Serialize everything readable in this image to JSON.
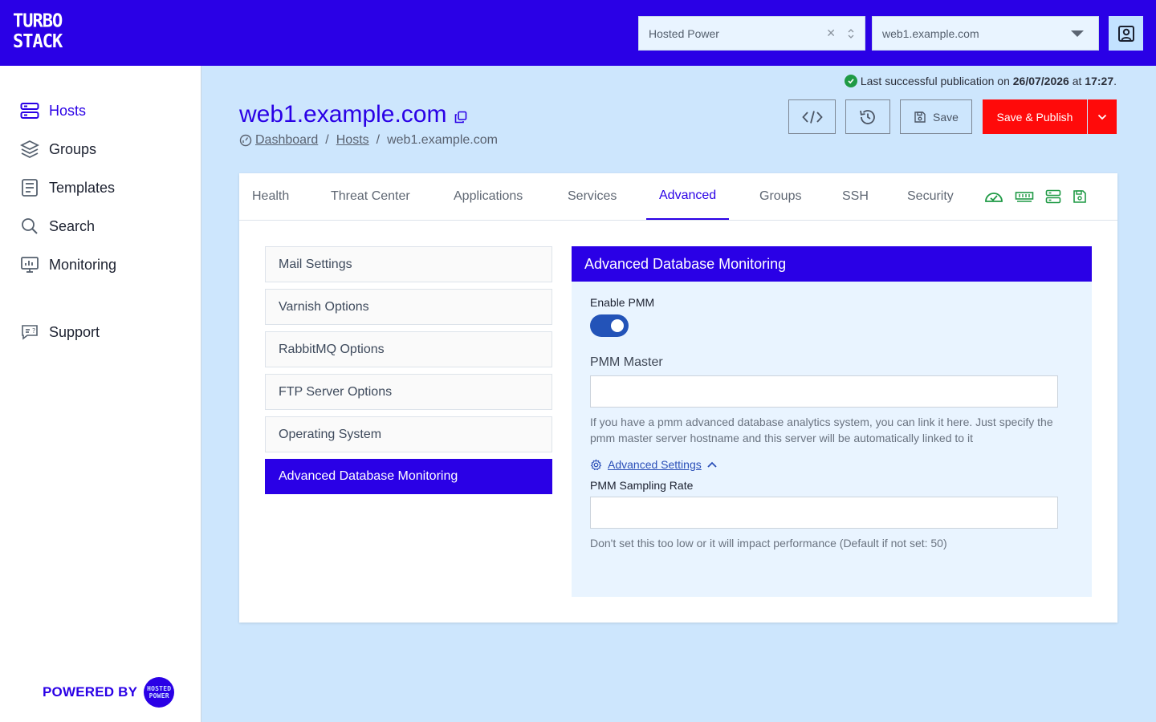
{
  "header": {
    "logo_line1": "TURBO",
    "logo_line2": "STACK",
    "org_select": {
      "value": "Hosted Power"
    },
    "host_select": {
      "value": "web1.example.com"
    }
  },
  "sidebar": {
    "items": [
      {
        "label": "Hosts",
        "icon": "server-icon",
        "active": true
      },
      {
        "label": "Groups",
        "icon": "layers-icon"
      },
      {
        "label": "Templates",
        "icon": "template-icon"
      },
      {
        "label": "Search",
        "icon": "search-icon"
      },
      {
        "label": "Monitoring",
        "icon": "monitor-icon"
      },
      {
        "label": "Support",
        "icon": "support-icon"
      }
    ],
    "powered_by": "POWERED BY",
    "powered_logo_text": "HOSTED POWER"
  },
  "status": {
    "prefix": "Last successful publication on",
    "date": "26/07/2026",
    "mid": "at",
    "time": "17:27",
    "suffix": "."
  },
  "page": {
    "title": "web1.example.com",
    "breadcrumb": [
      "Dashboard",
      "Hosts",
      "web1.example.com"
    ]
  },
  "toolbar": {
    "save_label": "Save",
    "publish_label": "Save & Publish"
  },
  "tabs": [
    "Health",
    "Threat Center",
    "Applications",
    "Services",
    "Advanced",
    "Groups",
    "SSH",
    "Security"
  ],
  "active_tab": "Advanced",
  "advanced_menu": [
    "Mail Settings",
    "Varnish Options",
    "RabbitMQ Options",
    "FTP Server Options",
    "Operating System",
    "Advanced Database Monitoring"
  ],
  "panel": {
    "title": "Advanced Database Monitoring",
    "enable_label": "Enable PMM",
    "enable_value": true,
    "master_label": "PMM Master",
    "master_value": "",
    "master_help": "If you have a pmm advanced database analytics system, you can link it here. Just specify the pmm master server hostname and this server will be automatically linked to it",
    "advanced_settings_label": "Advanced Settings",
    "sampling_label": "PMM Sampling Rate",
    "sampling_value": "",
    "sampling_help": "Don't set this too low or it will impact performance (Default if not set: 50)"
  },
  "colors": {
    "brand": "#2a00e6",
    "danger": "#ff0a0a",
    "success": "#1f9a45",
    "page_bg": "#cde6fd"
  }
}
